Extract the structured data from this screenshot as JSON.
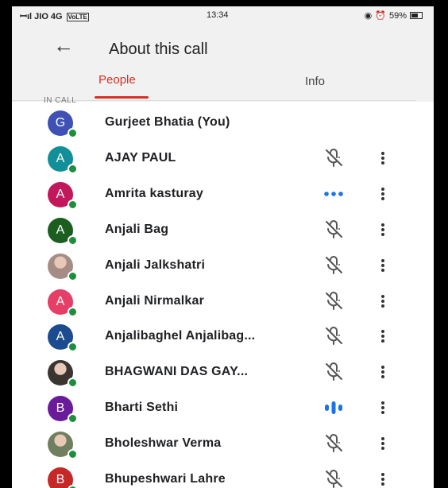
{
  "status_bar": {
    "carrier": "JIO 4G",
    "volte": "VoLTE",
    "time": "13:34",
    "battery": "59%"
  },
  "header": {
    "title": "About this call",
    "back_icon": "arrow-left-icon"
  },
  "tabs": [
    {
      "label": "People",
      "active": true
    },
    {
      "label": "Info",
      "active": false
    }
  ],
  "section_label": "IN CALL",
  "colors": {
    "accent": "#d93025",
    "presence": "#1e8e3e",
    "speaking": "#1a73e8"
  },
  "participants": [
    {
      "name": "Gurjeet Bhatia (You)",
      "initial": "G",
      "avatar_color": "#3f51b5",
      "photo": false,
      "mic": "none"
    },
    {
      "name": "AJAY PAUL",
      "initial": "A",
      "avatar_color": "#138f99",
      "photo": false,
      "mic": "muted"
    },
    {
      "name": "Amrita kasturay",
      "initial": "A",
      "avatar_color": "#c2185b",
      "photo": false,
      "mic": "connecting"
    },
    {
      "name": "Anjali Bag",
      "initial": "A",
      "avatar_color": "#1b5e20",
      "photo": false,
      "mic": "muted"
    },
    {
      "name": "Anjali Jalkshatri",
      "initial": "",
      "avatar_color": "#a58d85",
      "photo": true,
      "mic": "muted"
    },
    {
      "name": "Anjali Nirmalkar",
      "initial": "A",
      "avatar_color": "#e53f67",
      "photo": false,
      "mic": "muted"
    },
    {
      "name": "Anjalibaghel Anjalibag...",
      "initial": "A",
      "avatar_color": "#1d4b8f",
      "photo": false,
      "mic": "muted"
    },
    {
      "name": "BHAGWANI DAS GAY...",
      "initial": "",
      "avatar_color": "#3a3530",
      "photo": true,
      "mic": "muted"
    },
    {
      "name": "Bharti Sethi",
      "initial": "B",
      "avatar_color": "#6a1b9a",
      "photo": false,
      "mic": "speaking"
    },
    {
      "name": "Bholeshwar Verma",
      "initial": "",
      "avatar_color": "#6f7f5f",
      "photo": true,
      "mic": "muted"
    },
    {
      "name": "Bhupeshwari Lahre",
      "initial": "B",
      "avatar_color": "#c62828",
      "photo": false,
      "mic": "muted"
    }
  ]
}
